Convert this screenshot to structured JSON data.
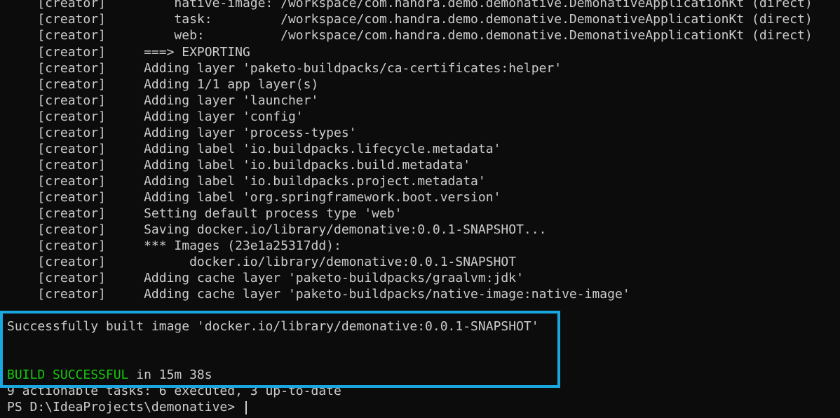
{
  "terminal": {
    "lines": [
      "    [creator]         native-image: /workspace/com.handra.demo.demonative.DemonativeApplicationKt (direct)",
      "    [creator]         task:         /workspace/com.handra.demo.demonative.DemonativeApplicationKt (direct)",
      "    [creator]         web:          /workspace/com.handra.demo.demonative.DemonativeApplicationKt (direct)",
      "    [creator]     ===> EXPORTING",
      "    [creator]     Adding layer 'paketo-buildpacks/ca-certificates:helper'",
      "    [creator]     Adding 1/1 app layer(s)",
      "    [creator]     Adding layer 'launcher'",
      "    [creator]     Adding layer 'config'",
      "    [creator]     Adding layer 'process-types'",
      "    [creator]     Adding label 'io.buildpacks.lifecycle.metadata'",
      "    [creator]     Adding label 'io.buildpacks.build.metadata'",
      "    [creator]     Adding label 'io.buildpacks.project.metadata'",
      "    [creator]     Adding label 'org.springframework.boot.version'",
      "    [creator]     Setting default process type 'web'",
      "    [creator]     Saving docker.io/library/demonative:0.0.1-SNAPSHOT...",
      "    [creator]     *** Images (23e1a25317dd):",
      "    [creator]           docker.io/library/demonative:0.0.1-SNAPSHOT",
      "    [creator]     Adding cache layer 'paketo-buildpacks/graalvm:jdk'",
      "    [creator]     Adding cache layer 'paketo-buildpacks/native-image:native-image'"
    ],
    "success_message": "Successfully built image 'docker.io/library/demonative:0.0.1-SNAPSHOT'",
    "build_status": "BUILD SUCCESSFUL",
    "build_time": " in 15m 38s",
    "tasks_summary": "9 actionable tasks: 6 executed, 3 up-to-date",
    "prompt": "PS D:\\IdeaProjects\\demonative> "
  },
  "colors": {
    "background": "#0c0c0c",
    "text": "#cccccc",
    "success_green": "#16c60c",
    "highlight_border": "#1aa7e0"
  }
}
